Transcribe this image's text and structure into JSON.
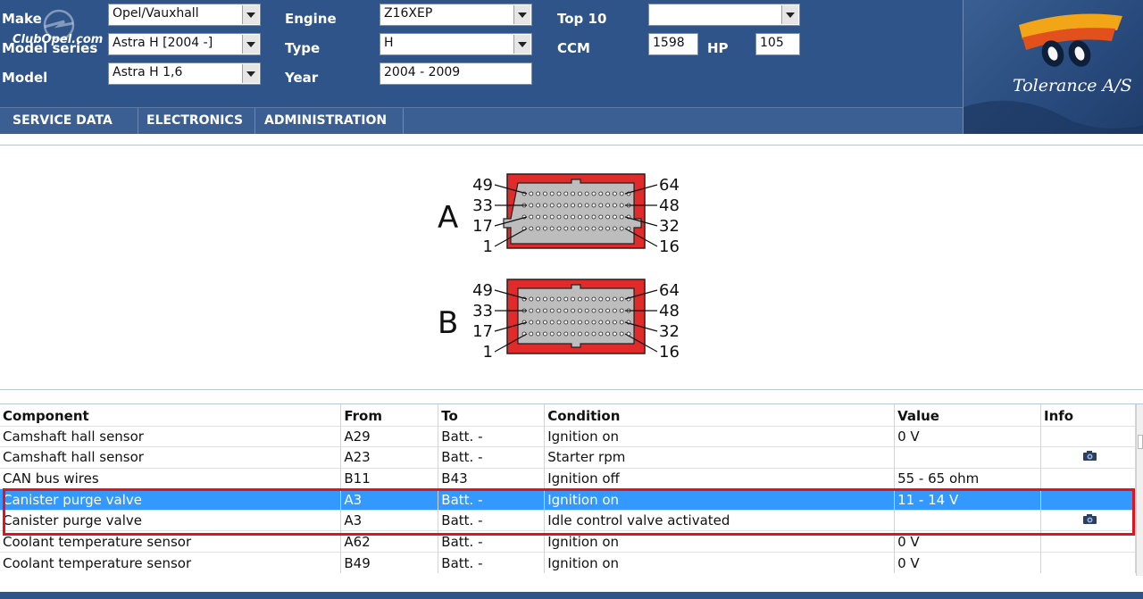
{
  "header": {
    "make_label": "Make",
    "make_value": "Opel/Vauxhall",
    "model_series_label": "Model series",
    "model_series_value": "Astra H [2004 -]",
    "model_label": "Model",
    "model_value": "Astra H 1,6",
    "engine_label": "Engine",
    "engine_value": "Z16XEP",
    "type_label": "Type",
    "type_value": "H",
    "year_label": "Year",
    "year_value": "2004 - 2009",
    "top10_label": "Top 10",
    "top10_value": "",
    "ccm_label": "CCM",
    "ccm_value": "1598",
    "hp_label": "HP",
    "hp_value": "105",
    "logo_watermark": "ClubOpel.com",
    "brand_text": "Tolerance A/S"
  },
  "nav": {
    "items": [
      "SERVICE DATA",
      "ELECTRONICS",
      "ADMINISTRATION"
    ]
  },
  "connectors": [
    {
      "name": "A",
      "pins_left": [
        "49",
        "33",
        "17",
        "1"
      ],
      "pins_right": [
        "64",
        "48",
        "32",
        "16"
      ]
    },
    {
      "name": "B",
      "pins_left": [
        "49",
        "33",
        "17",
        "1"
      ],
      "pins_right": [
        "64",
        "48",
        "32",
        "16"
      ]
    }
  ],
  "table": {
    "headers": [
      "Component",
      "From",
      "To",
      "Condition",
      "Value",
      "Info"
    ],
    "rows": [
      {
        "component": "Camshaft hall sensor",
        "from": "A29",
        "to": "Batt. -",
        "condition": "Ignition on",
        "value": "0 V",
        "info": ""
      },
      {
        "component": "Camshaft hall sensor",
        "from": "A23",
        "to": "Batt. -",
        "condition": "Starter rpm",
        "value": "",
        "info": "camera-icon"
      },
      {
        "component": "CAN bus wires",
        "from": "B11",
        "to": "B43",
        "condition": "Ignition off",
        "value": "55 - 65 ohm",
        "info": ""
      },
      {
        "component": "Canister purge valve",
        "from": "A3",
        "to": "Batt. -",
        "condition": "Ignition on",
        "value": "11 - 14 V",
        "info": ""
      },
      {
        "component": "Canister purge valve",
        "from": "A3",
        "to": "Batt. -",
        "condition": "Idle control valve activated",
        "value": "",
        "info": "camera-icon"
      },
      {
        "component": "Coolant temperature sensor",
        "from": "A62",
        "to": "Batt. -",
        "condition": "Ignition on",
        "value": "0 V",
        "info": ""
      },
      {
        "component": "Coolant temperature sensor",
        "from": "B49",
        "to": "Batt. -",
        "condition": "Ignition on",
        "value": "0 V",
        "info": ""
      }
    ],
    "selected_row": 3
  },
  "colors": {
    "header_bg": "#2f5489",
    "selection": "#3399ff",
    "connector_red": "#e12a2a",
    "highlight_box": "#e3121d"
  }
}
